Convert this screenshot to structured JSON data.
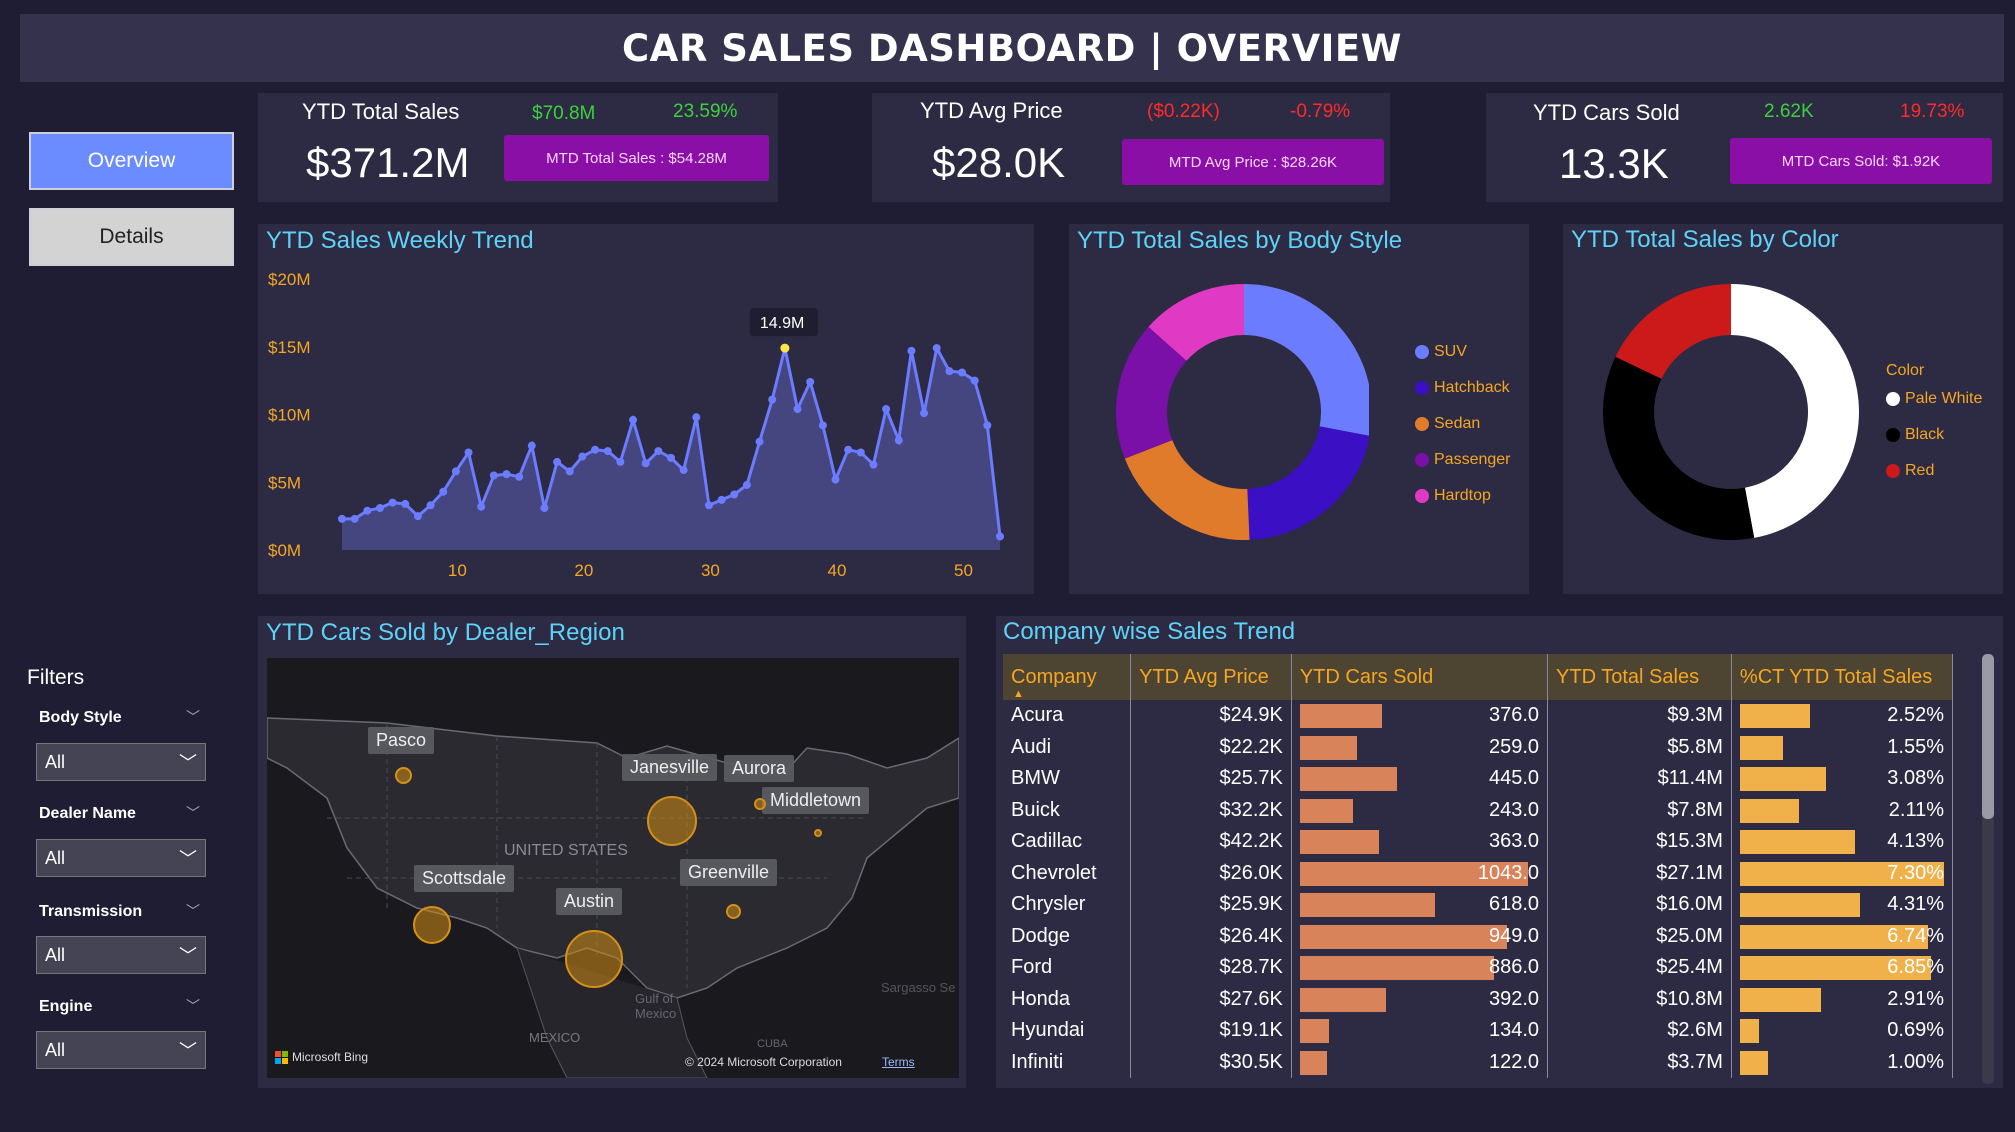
{
  "header": {
    "title": "CAR SALES DASHBOARD | OVERVIEW"
  },
  "nav": {
    "overview": "Overview",
    "details": "Details"
  },
  "kpis": [
    {
      "title": "YTD Total Sales",
      "value": "$371.2M",
      "delta_abs": "$70.8M",
      "delta_pct": "23.59%",
      "mtd": "MTD Total Sales : $54.28M",
      "delta_abs_color": "#3cd13c",
      "delta_pct_color": "#3cd13c"
    },
    {
      "title": "YTD Avg Price",
      "value": "$28.0K",
      "delta_abs": "($0.22K)",
      "delta_pct": "-0.79%",
      "mtd": "MTD Avg Price : $28.26K",
      "delta_abs_color": "#ff2a2a",
      "delta_pct_color": "#ff2a2a"
    },
    {
      "title": "YTD Cars Sold",
      "value": "13.3K",
      "delta_abs": "2.62K",
      "delta_pct": "19.73%",
      "mtd": "MTD Cars Sold: $1.92K",
      "delta_abs_color": "#3cd13c",
      "delta_pct_color": "#ff2a2a"
    }
  ],
  "panels": {
    "weekly": "YTD Sales Weekly Trend",
    "body": "YTD Total Sales by Body Style",
    "color": "YTD Total Sales by Color",
    "region": "YTD Cars Sold by Dealer_Region",
    "company": "Company wise Sales Trend"
  },
  "chart_data": [
    {
      "type": "area",
      "title": "YTD Sales Weekly Trend",
      "x": [
        1,
        2,
        3,
        4,
        5,
        6,
        7,
        8,
        9,
        10,
        11,
        12,
        13,
        14,
        15,
        16,
        17,
        18,
        19,
        20,
        21,
        22,
        23,
        24,
        25,
        26,
        27,
        28,
        29,
        30,
        31,
        32,
        33,
        34,
        35,
        36,
        37,
        38,
        39,
        40,
        41,
        42,
        43,
        44,
        45,
        46,
        47,
        48,
        49,
        50,
        51,
        52,
        53
      ],
      "values": [
        2.3,
        2.3,
        2.9,
        3.1,
        3.5,
        3.4,
        2.5,
        3.3,
        4.3,
        5.8,
        7.2,
        3.2,
        5.5,
        5.6,
        5.4,
        7.7,
        3.1,
        6.5,
        5.8,
        6.9,
        7.4,
        7.3,
        6.5,
        9.6,
        6.4,
        7.3,
        6.8,
        5.9,
        9.8,
        3.3,
        3.7,
        4.1,
        4.8,
        8.0,
        11.1,
        14.9,
        10.4,
        12.4,
        9.2,
        5.2,
        7.4,
        7.2,
        6.3,
        10.4,
        8.1,
        14.7,
        10.1,
        14.9,
        13.2,
        13.1,
        12.5,
        9.2,
        1.0
      ],
      "xticks": [
        "10",
        "20",
        "30",
        "40",
        "50"
      ],
      "yticks": [
        "$0M",
        "$5M",
        "$10M",
        "$15M",
        "$20M"
      ],
      "ylim": [
        0,
        20
      ],
      "annotation": "14.9M",
      "color": "#6b7cff"
    },
    {
      "type": "pie",
      "title": "YTD Total Sales by Body Style",
      "labels": [
        "SUV",
        "Hatchback",
        "Sedan",
        "Passenger",
        "Hardtop"
      ],
      "values": [
        26.5,
        20.2,
        18.7,
        16.6,
        12.7
      ],
      "colors": [
        "#6b7cff",
        "#3b0fc4",
        "#e07b2c",
        "#7a10a8",
        "#e03ac4"
      ]
    },
    {
      "type": "pie",
      "title": "YTD Total Sales by Color",
      "legend_title": "Color",
      "labels": [
        "Pale White",
        "Black",
        "Red"
      ],
      "values": [
        47.1,
        35.0,
        17.9
      ],
      "colors": [
        "#ffffff",
        "#000000",
        "#cc1a1a"
      ]
    }
  ],
  "legend_title_color": "Color",
  "filters": {
    "title": "Filters",
    "items": [
      {
        "label": "Body Style",
        "value": "All"
      },
      {
        "label": "Dealer Name",
        "value": "All"
      },
      {
        "label": "Transmission",
        "value": "All"
      },
      {
        "label": "Engine",
        "value": "All"
      }
    ]
  },
  "map": {
    "cities": [
      "Pasco",
      "Janesville",
      "Aurora",
      "Middletown",
      "Scottsdale",
      "Austin",
      "Greenville"
    ],
    "country_label": "UNITED STATES",
    "gulf_label": "Gulf of Mexico",
    "mexico_label": "MEXICO",
    "cuba_label": "CUBA",
    "sargasso_label": "Sargasso Se",
    "bing_label": "Microsoft Bing",
    "copyright": "© 2024 Microsoft Corporation",
    "terms": "Terms"
  },
  "table": {
    "headers": [
      "Company",
      "YTD Avg Price",
      "YTD Cars Sold",
      "YTD Total Sales",
      "%CT YTD Total Sales"
    ],
    "rows": [
      {
        "company": "Acura",
        "avg": "$24.9K",
        "sold": "376.0",
        "sold_v": 376,
        "total": "$9.3M",
        "pct": "2.52%",
        "pct_v": 2.52
      },
      {
        "company": "Audi",
        "avg": "$22.2K",
        "sold": "259.0",
        "sold_v": 259,
        "total": "$5.8M",
        "pct": "1.55%",
        "pct_v": 1.55
      },
      {
        "company": "BMW",
        "avg": "$25.7K",
        "sold": "445.0",
        "sold_v": 445,
        "total": "$11.4M",
        "pct": "3.08%",
        "pct_v": 3.08
      },
      {
        "company": "Buick",
        "avg": "$32.2K",
        "sold": "243.0",
        "sold_v": 243,
        "total": "$7.8M",
        "pct": "2.11%",
        "pct_v": 2.11
      },
      {
        "company": "Cadillac",
        "avg": "$42.2K",
        "sold": "363.0",
        "sold_v": 363,
        "total": "$15.3M",
        "pct": "4.13%",
        "pct_v": 4.13
      },
      {
        "company": "Chevrolet",
        "avg": "$26.0K",
        "sold": "1043.0",
        "sold_v": 1043,
        "total": "$27.1M",
        "pct": "7.30%",
        "pct_v": 7.3
      },
      {
        "company": "Chrysler",
        "avg": "$25.9K",
        "sold": "618.0",
        "sold_v": 618,
        "total": "$16.0M",
        "pct": "4.31%",
        "pct_v": 4.31
      },
      {
        "company": "Dodge",
        "avg": "$26.4K",
        "sold": "949.0",
        "sold_v": 949,
        "total": "$25.0M",
        "pct": "6.74%",
        "pct_v": 6.74
      },
      {
        "company": "Ford",
        "avg": "$28.7K",
        "sold": "886.0",
        "sold_v": 886,
        "total": "$25.4M",
        "pct": "6.85%",
        "pct_v": 6.85
      },
      {
        "company": "Honda",
        "avg": "$27.6K",
        "sold": "392.0",
        "sold_v": 392,
        "total": "$10.8M",
        "pct": "2.91%",
        "pct_v": 2.91
      },
      {
        "company": "Hyundai",
        "avg": "$19.1K",
        "sold": "134.0",
        "sold_v": 134,
        "total": "$2.6M",
        "pct": "0.69%",
        "pct_v": 0.69
      },
      {
        "company": "Infiniti",
        "avg": "$30.5K",
        "sold": "122.0",
        "sold_v": 122,
        "total": "$3.7M",
        "pct": "1.00%",
        "pct_v": 1.0
      }
    ]
  },
  "colors": {
    "accent_title": "#5fd2f7",
    "axis": "#f5a623",
    "sold_bar": "#d9835a",
    "pct_bar": "#f0b04a",
    "mtd_bg": "#8a0fa6"
  }
}
